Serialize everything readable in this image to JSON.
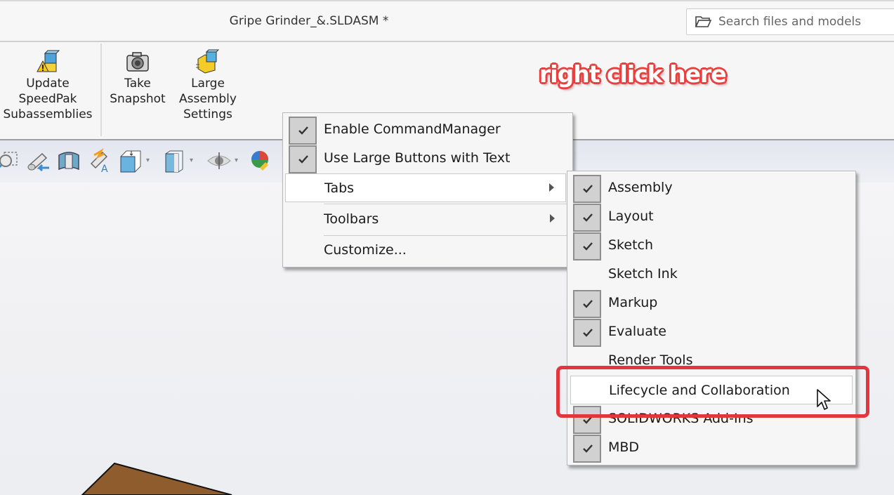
{
  "window": {
    "title": "Gripe Grinder_&.SLDASM *",
    "search": {
      "placeholder": "Search files and models",
      "icon": "folder-icon"
    }
  },
  "ribbon": {
    "buttons": [
      {
        "label_lines": [
          "Update",
          "SpeedPak",
          "Subassemblies"
        ],
        "icon": "speedpak-warning-icon"
      },
      {
        "label_lines": [
          "Take",
          "Snapshot"
        ],
        "icon": "camera-icon"
      },
      {
        "label_lines": [
          "Large",
          "Assembly",
          "Settings"
        ],
        "icon": "large-assembly-icon"
      }
    ]
  },
  "heads_up_toolbar": {
    "icons": [
      "zoom-to-area-icon",
      "previous-view-icon",
      "section-view-icon",
      "dynamic-annotation-views-icon",
      "view-orientation-icon",
      "display-style-icon",
      "hide-show-items-icon",
      "edit-appearance-icon"
    ]
  },
  "annotation": {
    "text": "right click here",
    "color": "#e8403f"
  },
  "context_menu": {
    "items": [
      {
        "label": "Enable CommandManager",
        "checked": true
      },
      {
        "label": "Use Large Buttons with Text",
        "checked": true
      },
      {
        "label": "Tabs",
        "submenu": true,
        "hovered": true
      },
      {
        "label": "Toolbars",
        "submenu": true
      },
      {
        "label": "Customize..."
      }
    ]
  },
  "tabs_submenu": {
    "items": [
      {
        "label": "Assembly",
        "checked": true
      },
      {
        "label": "Layout",
        "checked": true
      },
      {
        "label": "Sketch",
        "checked": true
      },
      {
        "label": "Sketch Ink",
        "checked": false
      },
      {
        "label": "Markup",
        "checked": true
      },
      {
        "label": "Evaluate",
        "checked": true
      },
      {
        "label": "Render Tools",
        "checked": false
      },
      {
        "label": "Lifecycle and Collaboration",
        "checked": false,
        "hovered": true,
        "highlighted": true
      },
      {
        "label": "SOLIDWORKS Add-Ins",
        "checked": true
      },
      {
        "label": "MBD",
        "checked": true
      }
    ],
    "highlight_color": "#e5353c"
  }
}
